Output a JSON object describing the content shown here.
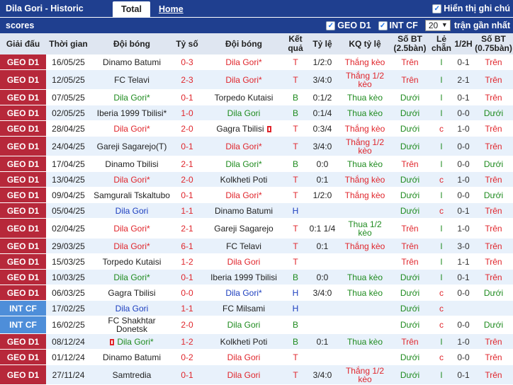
{
  "header": {
    "title": "Dila Gori - Historic scores",
    "tab_total": "Total",
    "tab_home": "Home",
    "show_notes": "Hiển thị ghi chú"
  },
  "filters": {
    "league1": "GEO D1",
    "league2": "INT CF",
    "count": "20",
    "recent_label": "trận gần nhất"
  },
  "columns": [
    "Giải đấu",
    "Thời gian",
    "Đội bóng",
    "Tỷ số",
    "Đội bóng",
    "Kết quả",
    "Tỷ lệ",
    "KQ tỷ lệ",
    "Số BT (2.5bàn)",
    "Lẻ chẵn",
    "1/2H",
    "Số BT (0.75bàn)"
  ],
  "colors": {
    "header_bg": "#1f3f8f",
    "geo_d1": "#b7283a",
    "int_cf": "#4e8ed9",
    "red": "#e0262c",
    "green": "#1f8b1f",
    "blue": "#1d3fbf"
  },
  "rows": [
    {
      "league": "GEO D1",
      "date": "16/05/25",
      "home": "Dinamo Batumi",
      "home_c": "",
      "score": "0-3",
      "away": "Dila Gori*",
      "away_c": "red",
      "res": "T",
      "res_c": "red",
      "odds": "1/2:0",
      "kq": "Thắng kèo",
      "kq_c": "red",
      "ou": "Trên",
      "ou_c": "red",
      "oe": "l",
      "oe_c": "green",
      "ht": "0-1",
      "ou2": "Trên",
      "ou2_c": "red"
    },
    {
      "league": "GEO D1",
      "date": "12/05/25",
      "home": "FC Telavi",
      "home_c": "",
      "score": "2-3",
      "away": "Dila Gori*",
      "away_c": "red",
      "res": "T",
      "res_c": "red",
      "odds": "3/4:0",
      "kq": "Thắng 1/2 kèo",
      "kq_c": "red",
      "ou": "Trên",
      "ou_c": "red",
      "oe": "l",
      "oe_c": "green",
      "ht": "2-1",
      "ou2": "Trên",
      "ou2_c": "red"
    },
    {
      "league": "GEO D1",
      "date": "07/05/25",
      "home": "Dila Gori*",
      "home_c": "green",
      "score": "0-1",
      "away": "Torpedo Kutaisi",
      "away_c": "",
      "res": "B",
      "res_c": "green",
      "odds": "0:1/2",
      "kq": "Thua kèo",
      "kq_c": "green",
      "ou": "Dưới",
      "ou_c": "green",
      "oe": "l",
      "oe_c": "green",
      "ht": "0-1",
      "ou2": "Trên",
      "ou2_c": "red"
    },
    {
      "league": "GEO D1",
      "date": "02/05/25",
      "home": "Iberia 1999 Tbilisi*",
      "home_c": "",
      "score": "1-0",
      "away": "Dila Gori",
      "away_c": "green",
      "res": "B",
      "res_c": "green",
      "odds": "0:1/4",
      "kq": "Thua kèo",
      "kq_c": "green",
      "ou": "Dưới",
      "ou_c": "green",
      "oe": "l",
      "oe_c": "green",
      "ht": "0-0",
      "ou2": "Dưới",
      "ou2_c": "green"
    },
    {
      "league": "GEO D1",
      "date": "28/04/25",
      "home": "Dila Gori*",
      "home_c": "red",
      "score": "2-0",
      "away": "Gagra Tbilisi",
      "away_c": "",
      "res": "T",
      "res_c": "red",
      "odds": "0:3/4",
      "kq": "Thắng kèo",
      "kq_c": "red",
      "ou": "Dưới",
      "ou_c": "green",
      "oe": "c",
      "oe_c": "red",
      "ht": "1-0",
      "ou2": "Trên",
      "ou2_c": "red"
    },
    {
      "league": "GEO D1",
      "date": "24/04/25",
      "home": "Gareji Sagarejo(T)",
      "home_c": "",
      "score": "0-1",
      "away": "Dila Gori*",
      "away_c": "red",
      "res": "T",
      "res_c": "red",
      "odds": "3/4:0",
      "kq": "Thắng 1/2 kèo",
      "kq_c": "red",
      "ou": "Dưới",
      "ou_c": "green",
      "oe": "l",
      "oe_c": "green",
      "ht": "0-0",
      "ou2": "Trên",
      "ou2_c": "red"
    },
    {
      "league": "GEO D1",
      "date": "17/04/25",
      "home": "Dinamo Tbilisi",
      "home_c": "",
      "score": "2-1",
      "away": "Dila Gori*",
      "away_c": "green",
      "res": "B",
      "res_c": "green",
      "odds": "0:0",
      "kq": "Thua kèo",
      "kq_c": "green",
      "ou": "Trên",
      "ou_c": "red",
      "oe": "l",
      "oe_c": "green",
      "ht": "0-0",
      "ou2": "Dưới",
      "ou2_c": "green"
    },
    {
      "league": "GEO D1",
      "date": "13/04/25",
      "home": "Dila Gori*",
      "home_c": "red",
      "score": "2-0",
      "away": "Kolkheti Poti",
      "away_c": "",
      "res": "T",
      "res_c": "red",
      "odds": "0:1",
      "kq": "Thắng kèo",
      "kq_c": "red",
      "ou": "Dưới",
      "ou_c": "green",
      "oe": "c",
      "oe_c": "red",
      "ht": "1-0",
      "ou2": "Trên",
      "ou2_c": "red"
    },
    {
      "league": "GEO D1",
      "date": "09/04/25",
      "home": "Samgurali Tskaltubo",
      "home_c": "",
      "score": "0-1",
      "away": "Dila Gori*",
      "away_c": "red",
      "res": "T",
      "res_c": "red",
      "odds": "1/2:0",
      "kq": "Thắng kèo",
      "kq_c": "red",
      "ou": "Dưới",
      "ou_c": "green",
      "oe": "l",
      "oe_c": "green",
      "ht": "0-0",
      "ou2": "Dưới",
      "ou2_c": "green"
    },
    {
      "league": "GEO D1",
      "date": "05/04/25",
      "home": "Dila Gori",
      "home_c": "blue",
      "score": "1-1",
      "away": "Dinamo Batumi",
      "away_c": "",
      "res": "H",
      "res_c": "blue",
      "odds": "",
      "kq": "",
      "kq_c": "",
      "ou": "Dưới",
      "ou_c": "green",
      "oe": "c",
      "oe_c": "red",
      "ht": "0-1",
      "ou2": "Trên",
      "ou2_c": "red"
    },
    {
      "league": "GEO D1",
      "date": "02/04/25",
      "home": "Dila Gori*",
      "home_c": "red",
      "score": "2-1",
      "away": "Gareji Sagarejo",
      "away_c": "",
      "res": "T",
      "res_c": "red",
      "odds": "0:1 1/4",
      "kq": "Thua 1/2 kèo",
      "kq_c": "green",
      "ou": "Trên",
      "ou_c": "red",
      "oe": "l",
      "oe_c": "green",
      "ht": "1-0",
      "ou2": "Trên",
      "ou2_c": "red"
    },
    {
      "league": "GEO D1",
      "date": "29/03/25",
      "home": "Dila Gori*",
      "home_c": "red",
      "score": "6-1",
      "away": "FC Telavi",
      "away_c": "",
      "res": "T",
      "res_c": "red",
      "odds": "0:1",
      "kq": "Thắng kèo",
      "kq_c": "red",
      "ou": "Trên",
      "ou_c": "red",
      "oe": "l",
      "oe_c": "green",
      "ht": "3-0",
      "ou2": "Trên",
      "ou2_c": "red"
    },
    {
      "league": "GEO D1",
      "date": "15/03/25",
      "home": "Torpedo Kutaisi",
      "home_c": "",
      "score": "1-2",
      "away": "Dila Gori",
      "away_c": "red",
      "res": "T",
      "res_c": "red",
      "odds": "",
      "kq": "",
      "kq_c": "",
      "ou": "Trên",
      "ou_c": "red",
      "oe": "l",
      "oe_c": "green",
      "ht": "1-1",
      "ou2": "Trên",
      "ou2_c": "red"
    },
    {
      "league": "GEO D1",
      "date": "10/03/25",
      "home": "Dila Gori*",
      "home_c": "green",
      "score": "0-1",
      "away": "Iberia 1999 Tbilisi",
      "away_c": "",
      "res": "B",
      "res_c": "green",
      "odds": "0:0",
      "kq": "Thua kèo",
      "kq_c": "green",
      "ou": "Dưới",
      "ou_c": "green",
      "oe": "l",
      "oe_c": "green",
      "ht": "0-1",
      "ou2": "Trên",
      "ou2_c": "red"
    },
    {
      "league": "GEO D1",
      "date": "06/03/25",
      "home": "Gagra Tbilisi",
      "home_c": "",
      "score": "0-0",
      "away": "Dila Gori*",
      "away_c": "blue",
      "res": "H",
      "res_c": "blue",
      "odds": "3/4:0",
      "kq": "Thua kèo",
      "kq_c": "green",
      "ou": "Dưới",
      "ou_c": "green",
      "oe": "c",
      "oe_c": "red",
      "ht": "0-0",
      "ou2": "Dưới",
      "ou2_c": "green"
    },
    {
      "league": "INT CF",
      "date": "17/02/25",
      "home": "Dila Gori",
      "home_c": "blue",
      "score": "1-1",
      "away": "FC Milsami",
      "away_c": "",
      "res": "H",
      "res_c": "blue",
      "odds": "",
      "kq": "",
      "kq_c": "",
      "ou": "Dưới",
      "ou_c": "green",
      "oe": "c",
      "oe_c": "red",
      "ht": "",
      "ou2": "",
      "ou2_c": ""
    },
    {
      "league": "INT CF",
      "date": "16/02/25",
      "home": "FC Shakhtar Donetsk",
      "home_c": "",
      "score": "2-0",
      "away": "Dila Gori",
      "away_c": "green",
      "res": "B",
      "res_c": "green",
      "odds": "",
      "kq": "",
      "kq_c": "",
      "ou": "Dưới",
      "ou_c": "green",
      "oe": "c",
      "oe_c": "red",
      "ht": "0-0",
      "ou2": "Dưới",
      "ou2_c": "green"
    },
    {
      "league": "GEO D1",
      "date": "08/12/24",
      "home": "Dila Gori*",
      "home_c": "green",
      "score": "1-2",
      "away": "Kolkheti Poti",
      "away_c": "",
      "res": "B",
      "res_c": "green",
      "odds": "0:1",
      "kq": "Thua kèo",
      "kq_c": "green",
      "ou": "Trên",
      "ou_c": "red",
      "oe": "l",
      "oe_c": "green",
      "ht": "1-0",
      "ou2": "Trên",
      "ou2_c": "red"
    },
    {
      "league": "GEO D1",
      "date": "01/12/24",
      "home": "Dinamo Batumi",
      "home_c": "",
      "score": "0-2",
      "away": "Dila Gori",
      "away_c": "red",
      "res": "T",
      "res_c": "red",
      "odds": "",
      "kq": "",
      "kq_c": "",
      "ou": "Dưới",
      "ou_c": "green",
      "oe": "c",
      "oe_c": "red",
      "ht": "0-0",
      "ou2": "Trên",
      "ou2_c": "red"
    },
    {
      "league": "GEO D1",
      "date": "27/11/24",
      "home": "Samtredia",
      "home_c": "",
      "score": "0-1",
      "away": "Dila Gori",
      "away_c": "red",
      "res": "T",
      "res_c": "red",
      "odds": "3/4:0",
      "kq": "Thắng 1/2 kèo",
      "kq_c": "red",
      "ou": "Dưới",
      "ou_c": "green",
      "oe": "l",
      "oe_c": "green",
      "ht": "0-1",
      "ou2": "Trên",
      "ou2_c": "red"
    }
  ]
}
